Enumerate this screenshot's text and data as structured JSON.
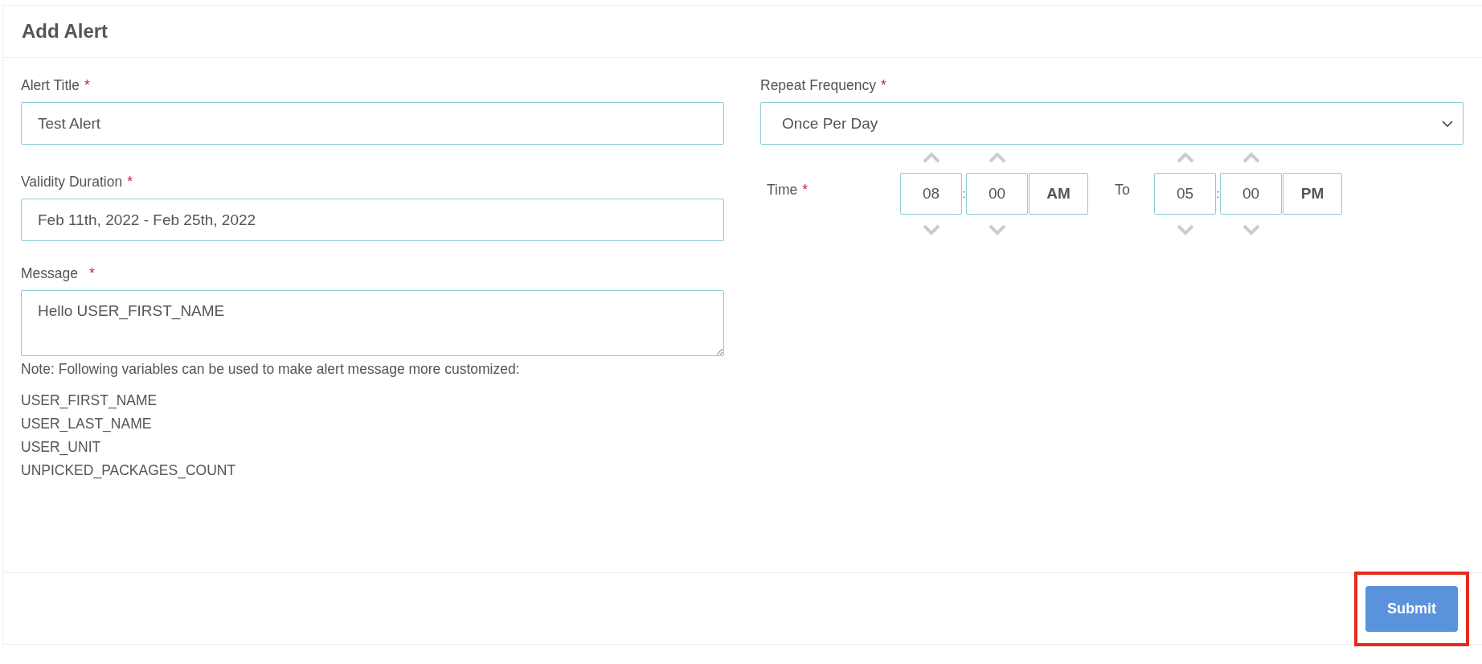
{
  "header": {
    "title": "Add Alert"
  },
  "fields": {
    "alert_title": {
      "label": "Alert Title",
      "required_mark": "*",
      "value": "Test Alert"
    },
    "repeat_frequency": {
      "label": "Repeat Frequency",
      "required_mark": "*",
      "value": "Once Per Day"
    },
    "validity_duration": {
      "label": "Validity Duration",
      "required_mark": "*",
      "value": "Feb 11th, 2022 - Feb 25th, 2022"
    },
    "time": {
      "label": "Time",
      "required_mark": "*",
      "separator_word": "To",
      "ranges": [
        {
          "hour": "08",
          "colon": ":",
          "minute": "00",
          "period": "AM"
        },
        {
          "hour": "05",
          "colon": ":",
          "minute": "00",
          "period": "PM"
        }
      ]
    },
    "message": {
      "label": "Message",
      "required_mark": "*",
      "value": "Hello USER_FIRST_NAME"
    }
  },
  "note": "Note: Following variables can be used to make alert message more customized:",
  "variables": [
    "USER_FIRST_NAME",
    "USER_LAST_NAME",
    "USER_UNIT",
    "UNPICKED_PACKAGES_COUNT"
  ],
  "footer": {
    "submit": {
      "label": "Submit",
      "highlighted": true
    }
  }
}
